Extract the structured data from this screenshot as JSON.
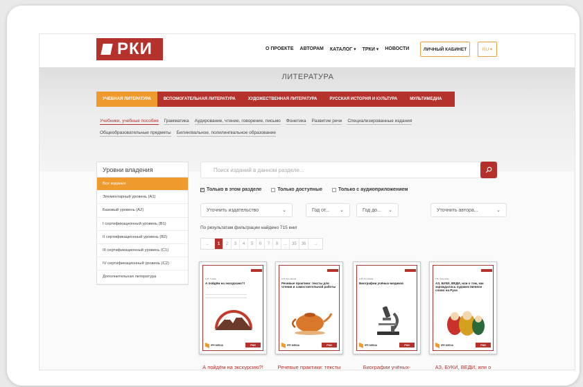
{
  "header": {
    "logo_text": "РКИ",
    "nav": [
      "О ПРОЕКТЕ",
      "АВТОРАМ",
      "КАТАЛОГ ▾",
      "ТРКИ ▾",
      "НОВОСТИ"
    ],
    "cabinet_label": "ЛИЧНЫЙ КАБИНЕТ",
    "lang_label": "RU ▾"
  },
  "hero": {
    "title": "ЛИТЕРАТУРА",
    "categories": [
      {
        "label": "УЧЕБНАЯ ЛИТЕРАТУРА",
        "active": true
      },
      {
        "label": "ВСПОМОГАТЕЛЬНАЯ ЛИТЕРАТУРА",
        "active": false
      },
      {
        "label": "ХУДОЖЕСТВЕННАЯ ЛИТЕРАТУРА",
        "active": false
      },
      {
        "label": "РУССКАЯ ИСТОРИЯ И КУЛЬТУРА",
        "active": false
      },
      {
        "label": "МУЛЬТИМЕДИА",
        "active": false
      }
    ],
    "subnav_row1": [
      "Учебники, учебные пособия",
      "Грамматика",
      "Аудирование, чтение, говорение, письмо",
      "Фонетика",
      "Развитие речи",
      "Специализированные издания"
    ],
    "subnav_row2": [
      "Общеобразовательные предметы",
      "Билингвальное, полилингвальное образование"
    ]
  },
  "sidebar": {
    "title": "Уровни владения",
    "items": [
      "Все издания",
      "Элементарный уровень (А1)",
      "Базовый уровень (А2)",
      "I сертификационный уровень (В1)",
      "II сертификационный уровень (В2)",
      "III сертификационный уровень (С1)",
      "IV сертификационный уровень (С2)",
      "Дополнительная литература"
    ]
  },
  "search": {
    "placeholder": "Поиск изданий в данном разделе..."
  },
  "checkboxes": [
    {
      "label": "Только в этом разделе",
      "checked": true
    },
    {
      "label": "Только доступные",
      "checked": false
    },
    {
      "label": "Только с аудиоприложением",
      "checked": false
    }
  ],
  "filters": {
    "publisher": "Уточнить издательство",
    "year_from": "Год от...",
    "year_to": "Год до...",
    "author": "Уточнить автора..."
  },
  "result_text": "По результатам фильтрации найдено 715 книг",
  "pagination": [
    "←",
    "1",
    "2",
    "3",
    "4",
    "5",
    "6",
    "7",
    "8",
    "...",
    "35",
    "36",
    "→"
  ],
  "books": [
    {
      "title": "А пойдём на экскурсию?!",
      "cover_author": "А.И. Глазко",
      "cover_title": "А пойдём на экскурсию?!",
      "publisher": "IPR MEDIA",
      "badge": "РКИ"
    },
    {
      "title": "Речевые практики: тексты",
      "cover_author": "А.В. Кретинина",
      "cover_title": "Речевые практики: тексты для чтения и самостоятельной работы",
      "publisher": "IPR MEDIA",
      "badge": "РКИ"
    },
    {
      "title": "Биографии учёных-",
      "cover_author": "А.В. Алтыпова",
      "cover_title": "Биографии учёных-медиков",
      "publisher": "IPR MEDIA",
      "badge": "РКИ"
    },
    {
      "title": "АЗ, БУКИ, ВЕДИ, или о",
      "cover_author": "Т.В. Соколова",
      "cover_title": "АЗ, БУКИ, ВЕДИ, или о том, как зарождалось художественное слово на Руси",
      "publisher": "IPR MEDIA",
      "badge": "РКИ"
    }
  ],
  "colors": {
    "brand": "#b5322c",
    "accent": "#ef9a2c"
  }
}
